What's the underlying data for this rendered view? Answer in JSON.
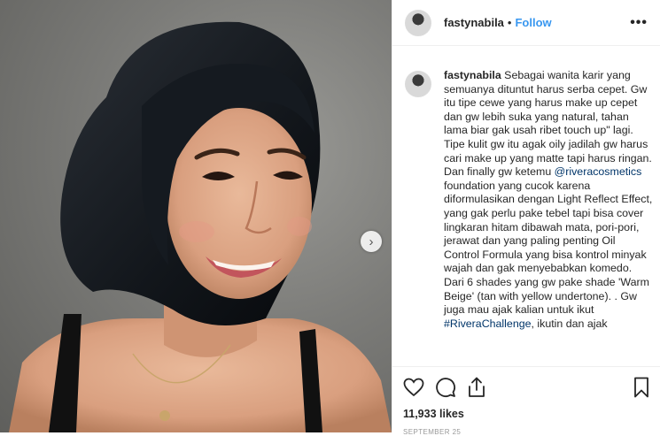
{
  "header": {
    "username": "fastynabila",
    "separator": "•",
    "follow_label": "Follow",
    "more_label": "•••"
  },
  "caption": {
    "username": "fastynabila",
    "text_1": " Sebagai wanita karir yang semuanya dituntut harus serba cepet. Gw itu tipe cewe yang harus make up cepet dan gw lebih suka yang natural, tahan lama biar gak usah ribet touch up\" lagi. Tipe kulit gw itu agak oily jadilah gw harus cari make up yang matte tapi harus ringan. Dan finally gw ketemu ",
    "mention": "@riveracosmetics",
    "text_2": " foundation yang cucok karena diformulasikan dengan Light Reflect Effect, yang gak perlu pake tebel tapi bisa cover lingkaran hitam dibawah mata, pori-pori, jerawat dan yang paling penting Oil Control Formula yang bisa kontrol minyak wajah dan gak menyebabkan komedo. Dari 6 shades yang gw pake shade 'Warm Beige' (tan with yellow undertone). . Gw juga mau ajak kalian untuk ikut ",
    "hashtag": "#RiveraChallenge",
    "text_3": ", ikutin dan ajak"
  },
  "carousel": {
    "next_label": "›"
  },
  "actions": {
    "like_icon": "heart-icon",
    "comment_icon": "comment-icon",
    "share_icon": "share-icon",
    "save_icon": "bookmark-icon"
  },
  "likes": "11,933 likes",
  "date": "SEPTEMBER 25",
  "colors": {
    "link": "#3897f0",
    "mention": "#003569",
    "border": "#efefef"
  }
}
